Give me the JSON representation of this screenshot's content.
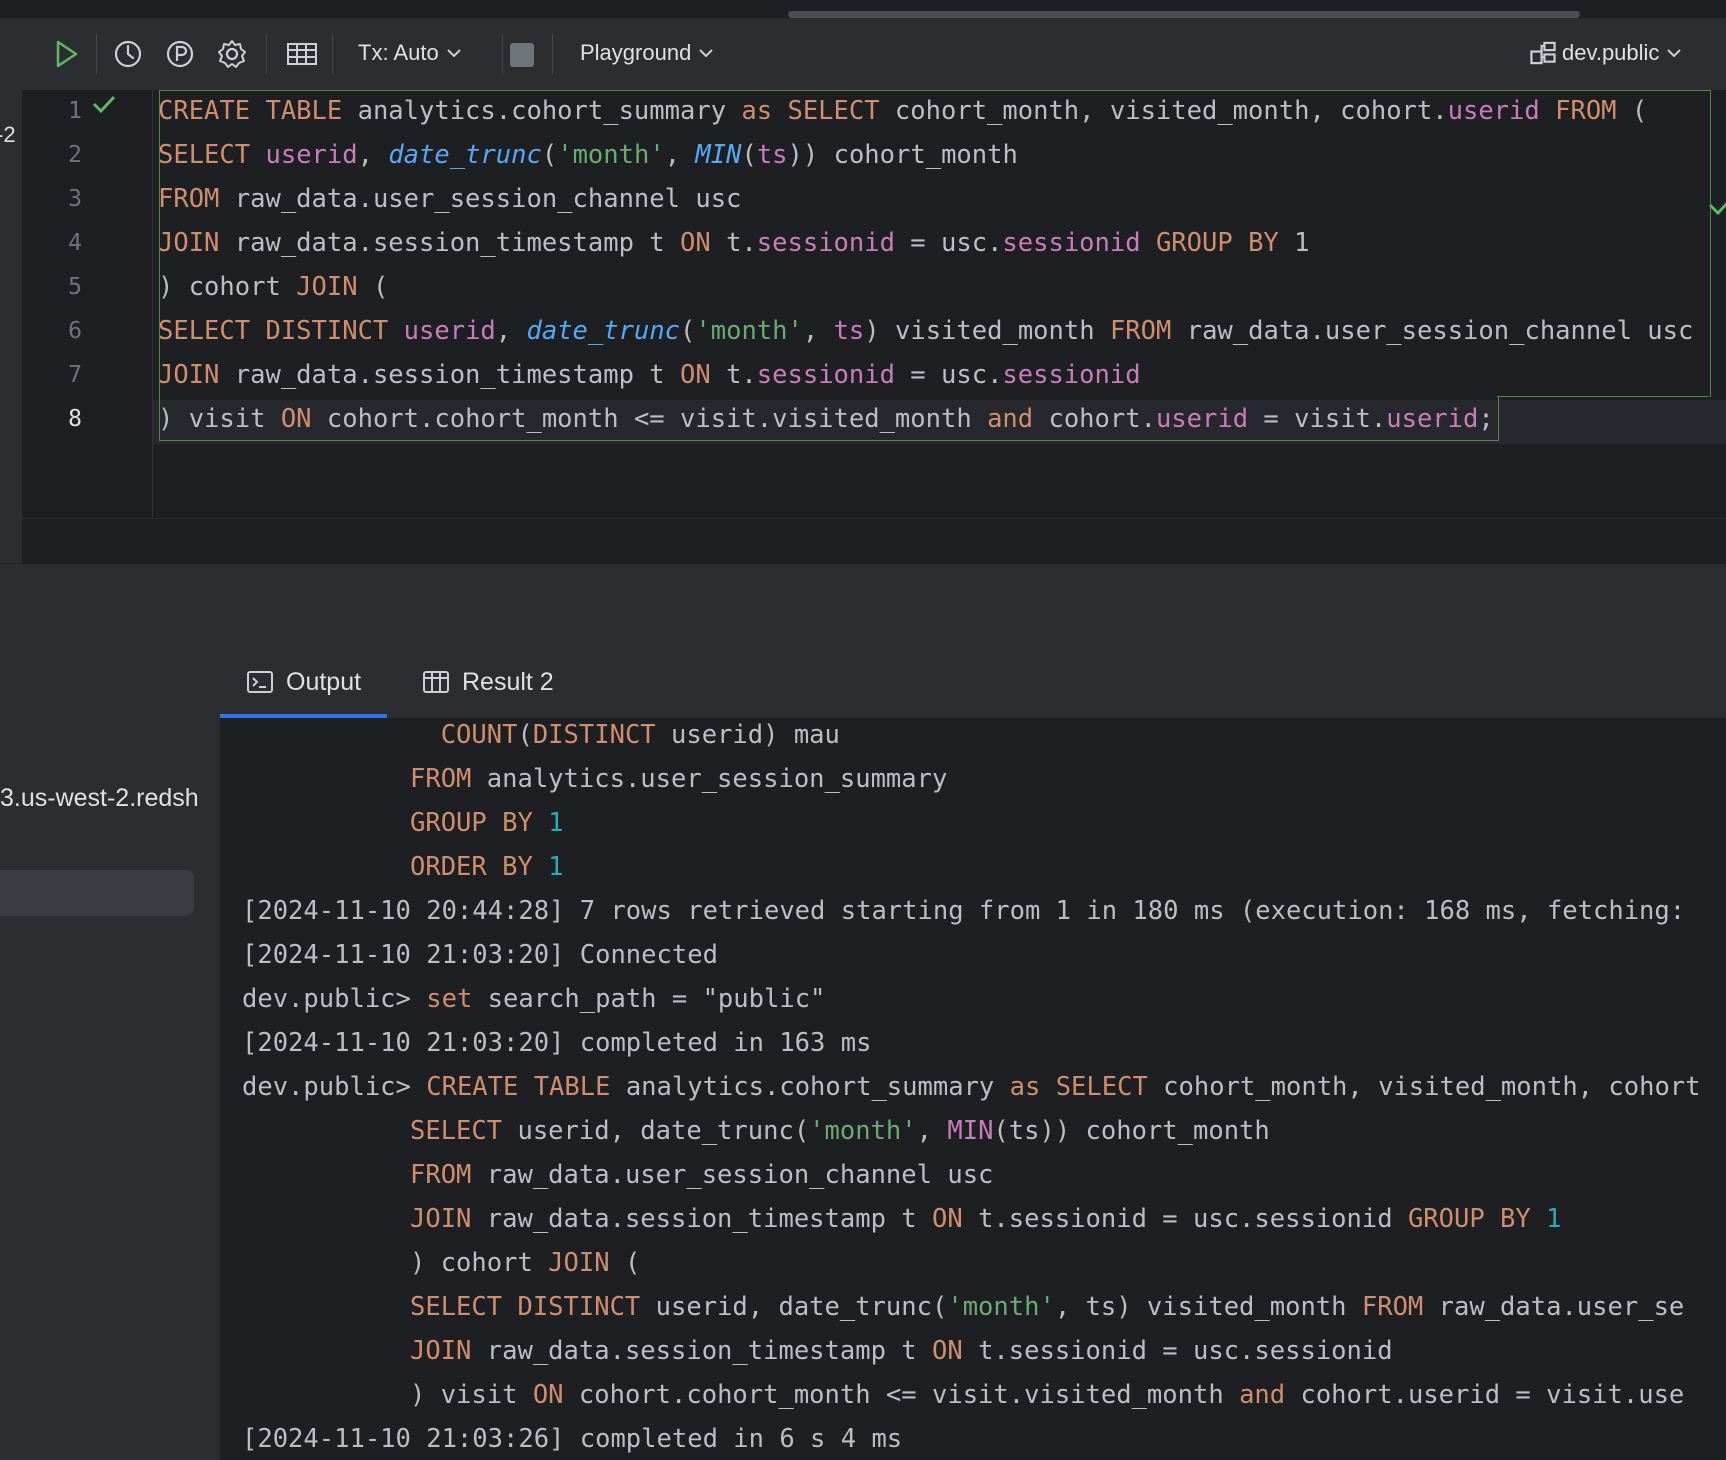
{
  "toolbar": {
    "tx_mode": "Tx: Auto",
    "session": "Playground",
    "schema": "dev.public"
  },
  "editor": {
    "line_numbers": [
      "1",
      "2",
      "3",
      "4",
      "5",
      "6",
      "7",
      "8"
    ],
    "lines": [
      [
        [
          "kw",
          "CREATE TABLE"
        ],
        [
          "p",
          " analytics.cohort_summary "
        ],
        [
          "kw",
          "as SELECT"
        ],
        [
          "p",
          " cohort_month, visited_month, cohort."
        ],
        [
          "fld",
          "userid"
        ],
        [
          "p",
          " "
        ],
        [
          "kw",
          "FROM"
        ],
        [
          "p",
          " ("
        ]
      ],
      [
        [
          "kw",
          "SELECT"
        ],
        [
          "p",
          " "
        ],
        [
          "fld",
          "userid"
        ],
        [
          "p",
          ", "
        ],
        [
          "fn-it",
          "date_trunc"
        ],
        [
          "p",
          "("
        ],
        [
          "str",
          "'month'"
        ],
        [
          "p",
          ", "
        ],
        [
          "fn-it",
          "MIN"
        ],
        [
          "p",
          "("
        ],
        [
          "fld",
          "ts"
        ],
        [
          "p",
          ")) cohort_month"
        ]
      ],
      [
        [
          "kw",
          "FROM"
        ],
        [
          "p",
          " raw_data.user_session_channel usc"
        ]
      ],
      [
        [
          "kw",
          "JOIN"
        ],
        [
          "p",
          " raw_data.session_timestamp t "
        ],
        [
          "kw",
          "ON"
        ],
        [
          "p",
          " t."
        ],
        [
          "fld",
          "sessionid"
        ],
        [
          "p",
          " = usc."
        ],
        [
          "fld",
          "sessionid"
        ],
        [
          "p",
          " "
        ],
        [
          "kw",
          "GROUP BY"
        ],
        [
          "p",
          " 1"
        ]
      ],
      [
        [
          "p",
          ") cohort "
        ],
        [
          "kw",
          "JOIN"
        ],
        [
          "p",
          " ("
        ]
      ],
      [
        [
          "kw",
          "SELECT DISTINCT"
        ],
        [
          "p",
          " "
        ],
        [
          "fld",
          "userid"
        ],
        [
          "p",
          ", "
        ],
        [
          "fn-it",
          "date_trunc"
        ],
        [
          "p",
          "("
        ],
        [
          "str",
          "'month'"
        ],
        [
          "p",
          ", "
        ],
        [
          "fld",
          "ts"
        ],
        [
          "p",
          ") visited_month "
        ],
        [
          "kw",
          "FROM"
        ],
        [
          "p",
          " raw_data.user_session_channel usc"
        ]
      ],
      [
        [
          "kw",
          "JOIN"
        ],
        [
          "p",
          " raw_data.session_timestamp t "
        ],
        [
          "kw",
          "ON"
        ],
        [
          "p",
          " t."
        ],
        [
          "fld",
          "sessionid"
        ],
        [
          "p",
          " = usc."
        ],
        [
          "fld",
          "sessionid"
        ]
      ],
      [
        [
          "p",
          ") visit "
        ],
        [
          "kw",
          "ON"
        ],
        [
          "p",
          " cohort.cohort_month <= visit.visited_month "
        ],
        [
          "kw",
          "and"
        ],
        [
          "p",
          " cohort."
        ],
        [
          "fld",
          "userid"
        ],
        [
          "p",
          " = visit."
        ],
        [
          "fld",
          "userid"
        ],
        [
          "p",
          ";"
        ]
      ]
    ]
  },
  "sidebar": {
    "host_fragment": "3.us-west-2.redsh",
    "left_tab_fragment": "-2"
  },
  "tabs": [
    {
      "label": "Output",
      "active": true
    },
    {
      "label": "Result 2",
      "active": false
    }
  ],
  "output": {
    "lines": [
      {
        "indent": 1,
        "segs": [
          [
            "kw",
            "  COUNT"
          ],
          [
            "p",
            "("
          ],
          [
            "kw",
            "DISTINCT"
          ],
          [
            "p",
            " userid) mau"
          ]
        ]
      },
      {
        "indent": 1,
        "segs": [
          [
            "kw",
            "FROM"
          ],
          [
            "p",
            " analytics.user_session_summary"
          ]
        ]
      },
      {
        "indent": 1,
        "segs": [
          [
            "kw",
            "GROUP BY"
          ],
          [
            "p",
            " "
          ],
          [
            "num",
            "1"
          ]
        ]
      },
      {
        "indent": 1,
        "segs": [
          [
            "kw",
            "ORDER BY"
          ],
          [
            "p",
            " "
          ],
          [
            "num",
            "1"
          ]
        ]
      },
      {
        "indent": 0,
        "segs": [
          [
            "p",
            "[2024-11-10 20:44:28] 7 rows retrieved starting from 1 in 180 ms (execution: 168 ms, fetching:"
          ]
        ]
      },
      {
        "indent": 0,
        "segs": [
          [
            "p",
            "[2024-11-10 21:03:20] Connected"
          ]
        ]
      },
      {
        "indent": 0,
        "segs": [
          [
            "p",
            "dev.public> "
          ],
          [
            "kw",
            "set"
          ],
          [
            "p",
            " search_path = \"public\""
          ]
        ]
      },
      {
        "indent": 0,
        "segs": [
          [
            "p",
            "[2024-11-10 21:03:20] completed in 163 ms"
          ]
        ]
      },
      {
        "indent": 0,
        "segs": [
          [
            "p",
            "dev.public> "
          ],
          [
            "kw",
            "CREATE TABLE"
          ],
          [
            "p",
            " analytics.cohort_summary "
          ],
          [
            "kw",
            "as SELECT"
          ],
          [
            "p",
            " cohort_month, visited_month, cohort"
          ]
        ]
      },
      {
        "indent": 1,
        "segs": [
          [
            "kw",
            "SELECT"
          ],
          [
            "p",
            " userid, date_trunc("
          ],
          [
            "str",
            "'month'"
          ],
          [
            "p",
            ", "
          ],
          [
            "fnc",
            "MIN"
          ],
          [
            "p",
            "(ts)) cohort_month"
          ]
        ]
      },
      {
        "indent": 1,
        "segs": [
          [
            "kw",
            "FROM"
          ],
          [
            "p",
            " raw_data.user_session_channel usc"
          ]
        ]
      },
      {
        "indent": 1,
        "segs": [
          [
            "kw",
            "JOIN"
          ],
          [
            "p",
            " raw_data.session_timestamp t "
          ],
          [
            "kw",
            "ON"
          ],
          [
            "p",
            " t.sessionid = usc.sessionid "
          ],
          [
            "kw",
            "GROUP BY"
          ],
          [
            "p",
            " "
          ],
          [
            "num",
            "1"
          ]
        ]
      },
      {
        "indent": 1,
        "segs": [
          [
            "p",
            ") cohort "
          ],
          [
            "kw",
            "JOIN"
          ],
          [
            "p",
            " ("
          ]
        ]
      },
      {
        "indent": 1,
        "segs": [
          [
            "kw",
            "SELECT DISTINCT"
          ],
          [
            "p",
            " userid, date_trunc("
          ],
          [
            "str",
            "'month'"
          ],
          [
            "p",
            ", ts) visited_month "
          ],
          [
            "kw",
            "FROM"
          ],
          [
            "p",
            " raw_data.user_se"
          ]
        ]
      },
      {
        "indent": 1,
        "segs": [
          [
            "kw",
            "JOIN"
          ],
          [
            "p",
            " raw_data.session_timestamp t "
          ],
          [
            "kw",
            "ON"
          ],
          [
            "p",
            " t.sessionid = usc.sessionid"
          ]
        ]
      },
      {
        "indent": 1,
        "segs": [
          [
            "p",
            ") visit "
          ],
          [
            "kw",
            "ON"
          ],
          [
            "p",
            " cohort.cohort_month <= visit.visited_month "
          ],
          [
            "kw",
            "and"
          ],
          [
            "p",
            " cohort.userid = visit.use"
          ]
        ]
      },
      {
        "indent": 0,
        "segs": [
          [
            "p",
            "[2024-11-10 21:03:26] completed in 6 s 4 ms"
          ]
        ]
      }
    ]
  },
  "colors": {
    "keyword": "#cf8e6d",
    "function": "#56a8f5",
    "string": "#6aab73",
    "field": "#c77dbb",
    "number": "#2aacb8",
    "accent": "#3574f0",
    "success": "#5fb865"
  },
  "icons": [
    "run-icon",
    "history-icon",
    "pin-icon",
    "settings-icon",
    "table-icon",
    "chevron-down-icon",
    "stop-icon",
    "schema-icon",
    "check-icon",
    "console-icon"
  ]
}
